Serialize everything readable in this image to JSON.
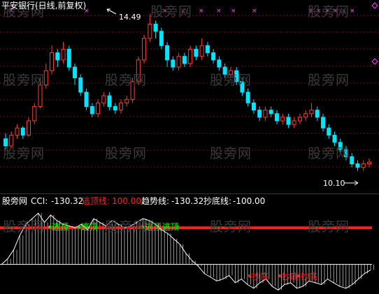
{
  "chart_title": "平安银行(日线,前复权)",
  "price_panel": {
    "high_label": "14.49",
    "low_label": "10.10",
    "colors": {
      "up": "#ff3b3b",
      "down": "#00e5ff",
      "signal": "#ff44ff",
      "grid": "#8b0000"
    }
  },
  "indicator_panel": {
    "source": "股旁网",
    "cci_label": "CCI:",
    "cci_value": "-130.32",
    "escape_label": "逃顶线:",
    "escape_value": "100.00",
    "trend_label": "趋势线:",
    "trend_value": "-130.32",
    "bottom_label": "抄底线:",
    "bottom_value": "-100.00",
    "top_signals": [
      "逃顶",
      "逃顶",
      "逃顶",
      "逃顶"
    ],
    "bottom_signals": [
      "抄底",
      "抄底",
      "抄底"
    ],
    "colors": {
      "cci": "#ffffff",
      "escape": "#ff2020",
      "trend": "#ffffff",
      "bottom": "#ffffff",
      "top_signal": "#00ff00",
      "bottom_signal": "#ff2020"
    }
  },
  "watermark": "股旁网",
  "chart_data": [
    {
      "type": "candlestick",
      "title": "平安银行(日线,前复权)",
      "annotations": [
        {
          "label": "14.49",
          "value": 14.49
        },
        {
          "label": "10.10",
          "value": 10.1
        }
      ],
      "candles": [
        [
          11.0,
          10.8,
          11.15,
          10.7
        ],
        [
          10.8,
          11.1,
          11.2,
          10.75
        ],
        [
          11.1,
          11.3,
          11.4,
          11.0
        ],
        [
          11.3,
          11.1,
          11.35,
          11.0
        ],
        [
          11.1,
          11.5,
          11.6,
          11.05
        ],
        [
          11.5,
          11.9,
          12.0,
          11.4
        ],
        [
          11.9,
          12.5,
          12.7,
          11.85
        ],
        [
          12.5,
          12.9,
          13.1,
          12.4
        ],
        [
          12.9,
          13.4,
          13.6,
          12.8
        ],
        [
          13.4,
          13.2,
          13.5,
          13.0
        ],
        [
          13.2,
          13.5,
          13.7,
          13.1
        ],
        [
          13.5,
          13.0,
          13.6,
          12.9
        ],
        [
          13.0,
          12.7,
          13.1,
          12.5
        ],
        [
          12.7,
          12.3,
          12.8,
          12.2
        ],
        [
          12.3,
          11.9,
          12.4,
          11.8
        ],
        [
          11.9,
          11.7,
          12.0,
          11.6
        ],
        [
          11.7,
          12.0,
          12.1,
          11.6
        ],
        [
          12.0,
          12.2,
          12.3,
          11.9
        ],
        [
          12.2,
          11.9,
          12.3,
          11.8
        ],
        [
          11.9,
          11.8,
          12.0,
          11.7
        ],
        [
          11.8,
          12.0,
          12.1,
          11.7
        ],
        [
          12.0,
          12.1,
          12.2,
          11.9
        ],
        [
          12.1,
          12.6,
          12.7,
          12.0
        ],
        [
          12.6,
          13.2,
          13.3,
          12.5
        ],
        [
          13.2,
          13.8,
          13.9,
          13.1
        ],
        [
          13.8,
          14.2,
          14.49,
          13.7
        ],
        [
          14.2,
          14.0,
          14.3,
          13.8
        ],
        [
          14.0,
          13.6,
          14.1,
          13.5
        ],
        [
          13.6,
          13.2,
          13.7,
          13.0
        ],
        [
          13.2,
          13.0,
          13.3,
          12.9
        ],
        [
          13.0,
          13.3,
          13.4,
          12.9
        ],
        [
          13.3,
          13.1,
          13.4,
          13.0
        ],
        [
          13.1,
          13.5,
          13.6,
          13.0
        ],
        [
          13.5,
          13.3,
          13.6,
          13.2
        ],
        [
          13.3,
          13.6,
          13.8,
          13.2
        ],
        [
          13.6,
          13.4,
          13.7,
          13.3
        ],
        [
          13.4,
          13.2,
          13.5,
          13.1
        ],
        [
          13.2,
          13.0,
          13.3,
          12.9
        ],
        [
          13.0,
          12.8,
          13.1,
          12.7
        ],
        [
          12.8,
          12.9,
          13.0,
          12.7
        ],
        [
          12.9,
          12.6,
          13.0,
          12.5
        ],
        [
          12.6,
          12.3,
          12.7,
          12.2
        ],
        [
          12.3,
          12.0,
          12.4,
          11.9
        ],
        [
          12.0,
          11.8,
          12.1,
          11.7
        ],
        [
          11.8,
          11.6,
          11.9,
          11.5
        ],
        [
          11.6,
          11.8,
          11.9,
          11.5
        ],
        [
          11.8,
          11.7,
          11.9,
          11.6
        ],
        [
          11.7,
          11.5,
          11.8,
          11.4
        ],
        [
          11.5,
          11.6,
          11.7,
          11.4
        ],
        [
          11.6,
          11.4,
          11.7,
          11.3
        ],
        [
          11.4,
          11.5,
          11.6,
          11.3
        ],
        [
          11.5,
          11.6,
          11.7,
          11.4
        ],
        [
          11.6,
          11.7,
          11.8,
          11.5
        ],
        [
          11.7,
          11.8,
          12.0,
          11.6
        ],
        [
          11.8,
          11.6,
          11.9,
          11.5
        ],
        [
          11.6,
          11.3,
          11.7,
          11.2
        ],
        [
          11.3,
          11.1,
          11.4,
          11.0
        ],
        [
          11.1,
          10.9,
          11.2,
          10.8
        ],
        [
          10.9,
          10.7,
          11.0,
          10.6
        ],
        [
          10.7,
          10.5,
          10.8,
          10.4
        ],
        [
          10.5,
          10.3,
          10.6,
          10.2
        ],
        [
          10.3,
          10.2,
          10.4,
          10.1
        ],
        [
          10.2,
          10.3,
          10.4,
          10.1
        ],
        [
          10.3,
          10.35,
          10.45,
          10.2
        ]
      ]
    },
    {
      "type": "line",
      "title": "CCI",
      "series": [
        {
          "name": "CCI",
          "values": [
            -100,
            -70,
            -20,
            60,
            120,
            150,
            180,
            130,
            170,
            140,
            120,
            110,
            100,
            120,
            90,
            150,
            130,
            110,
            140,
            120,
            100,
            110,
            130,
            150,
            140,
            120,
            90,
            70,
            40,
            10,
            -40,
            -80,
            -110,
            -150,
            -170,
            -190,
            -180,
            -160,
            -200,
            -180,
            -210,
            -230,
            -200,
            -180,
            -220,
            -240,
            -210,
            -200,
            -230,
            -220,
            -190,
            -200,
            -210,
            -180,
            -200,
            -220,
            -230,
            -210,
            -180,
            -150,
            -130.32
          ]
        },
        {
          "name": "逃顶线",
          "values": [
            100
          ]
        },
        {
          "name": "抄底线",
          "values": [
            -100
          ]
        }
      ]
    }
  ]
}
